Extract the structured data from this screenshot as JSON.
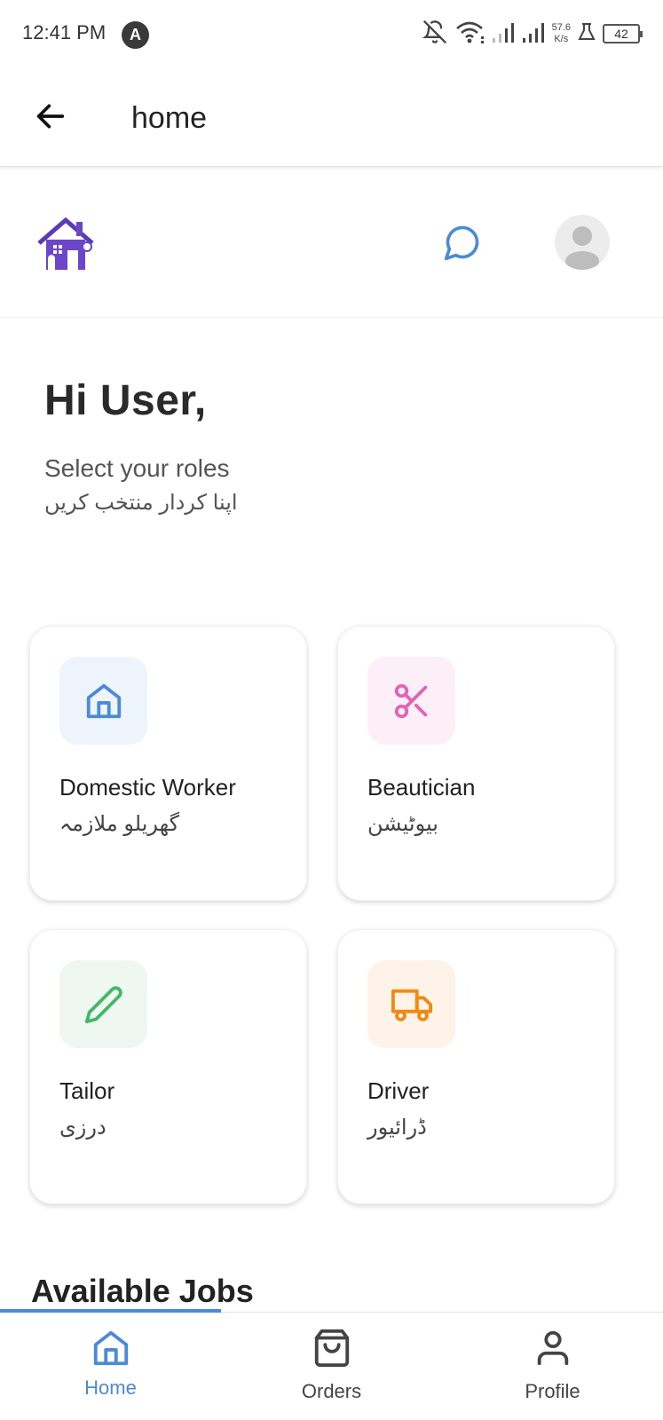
{
  "status_bar": {
    "time": "12:41 PM",
    "notif_letter": "A",
    "speed_value": "57.6",
    "speed_unit": "K/s",
    "battery": "42"
  },
  "app_bar": {
    "title": "home"
  },
  "greeting": {
    "title": "Hi User,",
    "subtitle": "Select your roles",
    "subtitle_urdu": "اپنا کردار منتخب کریں"
  },
  "roles": [
    {
      "label": "Domestic Worker",
      "urdu": "گھریلو ملازمہ",
      "icon": "home-icon",
      "color": "#4a8ad6",
      "bg": "#edf4fc"
    },
    {
      "label": "Beautician",
      "urdu": "بیوٹیشن",
      "icon": "scissors-icon",
      "color": "#e165b4",
      "bg": "#fdeff7"
    },
    {
      "label": "Tailor",
      "urdu": "درزی",
      "icon": "pencil-icon",
      "color": "#43b869",
      "bg": "#eef8f1"
    },
    {
      "label": "Driver",
      "urdu": "ڈرائیور",
      "icon": "truck-icon",
      "color": "#f08a12",
      "bg": "#fdf3e8"
    }
  ],
  "section": {
    "available_jobs": "Available Jobs"
  },
  "bottom_nav": {
    "items": [
      {
        "label": "Home",
        "icon": "home-icon",
        "active": true
      },
      {
        "label": "Orders",
        "icon": "shopping-bag-icon",
        "active": false
      },
      {
        "label": "Profile",
        "icon": "person-icon",
        "active": false
      }
    ],
    "accent": "#4a8ad6"
  }
}
